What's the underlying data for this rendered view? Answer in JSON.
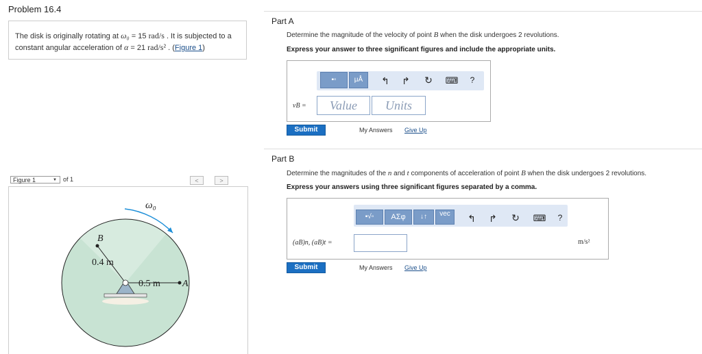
{
  "problem": {
    "title": "Problem 16.4",
    "text_pre": "The disk is originally rotating at ",
    "omega0_sym": "ω₀",
    "text_eq1": " = 15 ",
    "unit1": "rad/s",
    "text_mid": " . It is subjected to a constant angular acceleration of ",
    "alpha_sym": "α",
    "text_eq2": " = 21 ",
    "unit2": "rad/s²",
    "text_end": " . (",
    "figure_link": "Figure 1",
    "close": ")"
  },
  "figure": {
    "select_label": "Figure 1",
    "of_label": "of 1",
    "prev": "<",
    "next": ">",
    "labels": {
      "omega": "ω₀",
      "point_b": "B",
      "radius_b": "0.4 m",
      "radius_a": "0.5 m",
      "point_a": "A"
    },
    "colors": {
      "disk": "#c8e3d3",
      "disk_stroke": "#222",
      "arrow": "#1e8fd8"
    }
  },
  "partA": {
    "title": "Part A",
    "desc_pre": "Determine the magnitude of the velocity of point ",
    "point": "B",
    "desc_post": " when the disk undergoes 2 revolutions.",
    "instr": "Express your answer to three significant figures and include the appropriate units.",
    "toolbar": {
      "btn_template": "▪▫",
      "btn_units": "μÅ",
      "undo": "↰",
      "redo": "↱",
      "reset": "↻",
      "keyboard": "⌨",
      "help": "?"
    },
    "var_label": "vB =",
    "value_placeholder": "Value",
    "units_placeholder": "Units",
    "submit": "Submit",
    "my_answers": "My Answers",
    "give_up": "Give Up"
  },
  "partB": {
    "title": "Part B",
    "desc_pre": "Determine the magnitudes of the ",
    "n": "n",
    "desc_and": " and ",
    "t": "t",
    "desc_mid": " components of acceleration of point ",
    "point": "B",
    "desc_post": " when the disk undergoes 2 revolutions.",
    "instr": "Express your answers using three significant figures separated by a comma.",
    "toolbar": {
      "btn_sqrt": "▪√▫",
      "btn_greek": "ΑΣφ",
      "btn_arrows": "↓↑",
      "btn_vec": "vec",
      "undo": "↰",
      "redo": "↱",
      "reset": "↻",
      "keyboard": "⌨",
      "help": "?"
    },
    "var_label": "(aB)n, (aB)t =",
    "units": "m/s²",
    "submit": "Submit",
    "my_answers": "My Answers",
    "give_up": "Give Up"
  }
}
